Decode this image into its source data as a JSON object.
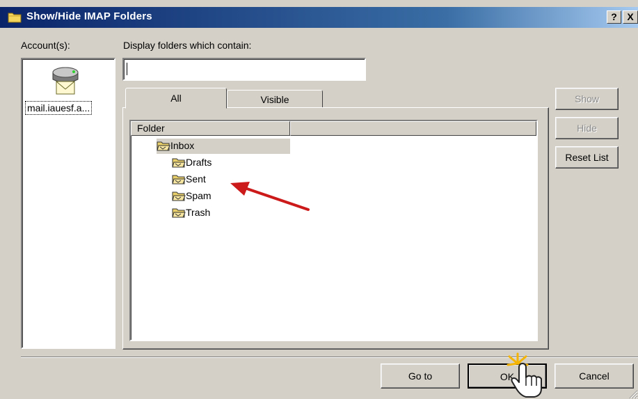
{
  "window": {
    "title": "Show/Hide IMAP Folders",
    "help_label": "?",
    "close_label": "X"
  },
  "accounts": {
    "label": "Account(s):",
    "items": [
      {
        "name": "mail.iauesf.a...",
        "icon": "mail-server-icon"
      }
    ]
  },
  "filter": {
    "label": "Display folders which contain:",
    "value": ""
  },
  "tabs": [
    {
      "label": "All",
      "selected": true
    },
    {
      "label": "Visible",
      "selected": false
    }
  ],
  "folder_list": {
    "columns": [
      "Folder",
      ""
    ],
    "items": [
      {
        "label": "Inbox",
        "icon": "folder-icon",
        "level": 0,
        "selected": true
      },
      {
        "label": "Drafts",
        "icon": "folder-icon",
        "level": 1
      },
      {
        "label": "Sent",
        "icon": "folder-icon",
        "level": 1
      },
      {
        "label": "Spam",
        "icon": "folder-icon",
        "level": 1
      },
      {
        "label": "Trash",
        "icon": "folder-icon",
        "level": 1
      }
    ]
  },
  "side_buttons": {
    "show": {
      "label": "Show",
      "enabled": false
    },
    "hide": {
      "label": "Hide",
      "enabled": false
    },
    "reset": {
      "label": "Reset List",
      "enabled": true
    }
  },
  "footer_buttons": {
    "goto": "Go to",
    "ok": "OK",
    "cancel": "Cancel"
  },
  "annotations": {
    "arrow_color": "#cc1a1a",
    "cursor": "hand-pointer-icon"
  }
}
